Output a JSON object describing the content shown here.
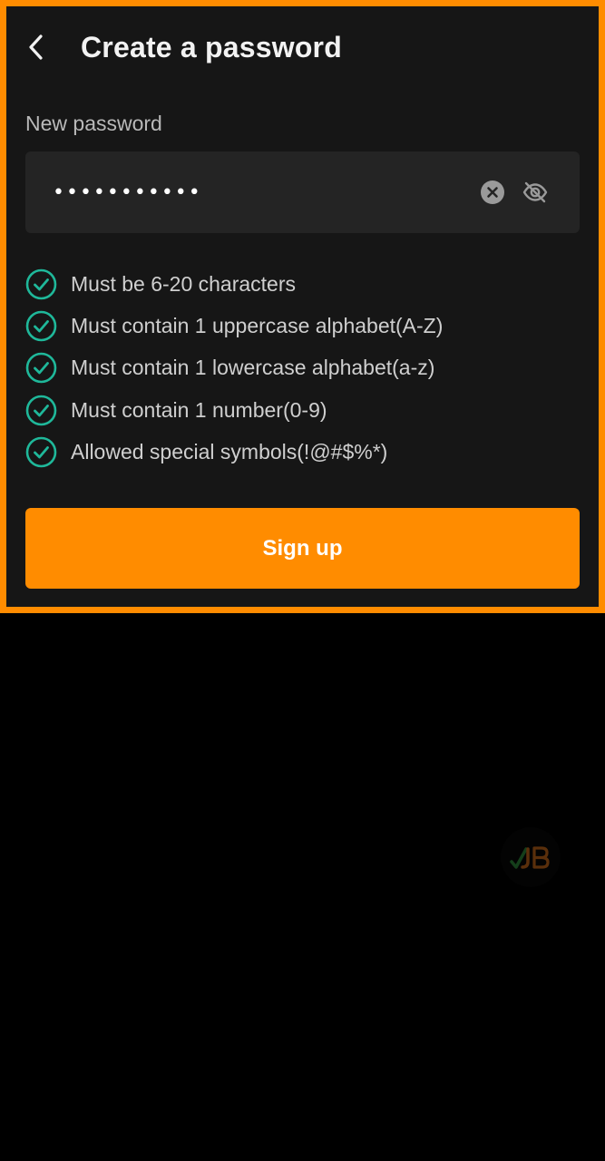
{
  "header": {
    "title": "Create a password",
    "back_icon": "chevron-left-icon"
  },
  "password_field": {
    "label": "New password",
    "value": "•••••••••••",
    "clear_icon": "clear-circle-icon",
    "visibility_icon": "eye-off-icon"
  },
  "rules": [
    {
      "text": "Must be 6-20 characters",
      "satisfied": true
    },
    {
      "text": "Must contain 1 uppercase alphabet(A-Z)",
      "satisfied": true
    },
    {
      "text": "Must contain 1 lowercase alphabet(a-z)",
      "satisfied": true
    },
    {
      "text": "Must contain 1 number(0-9)",
      "satisfied": true
    },
    {
      "text": "Allowed special symbols(!@#$%*)",
      "satisfied": true
    }
  ],
  "signup": {
    "label": "Sign up"
  },
  "colors": {
    "accent": "#ff8c00",
    "check": "#1fb89a",
    "panel_bg": "#161616",
    "input_bg": "#242424"
  },
  "logo": {
    "icon": "brand-logo-icon"
  }
}
